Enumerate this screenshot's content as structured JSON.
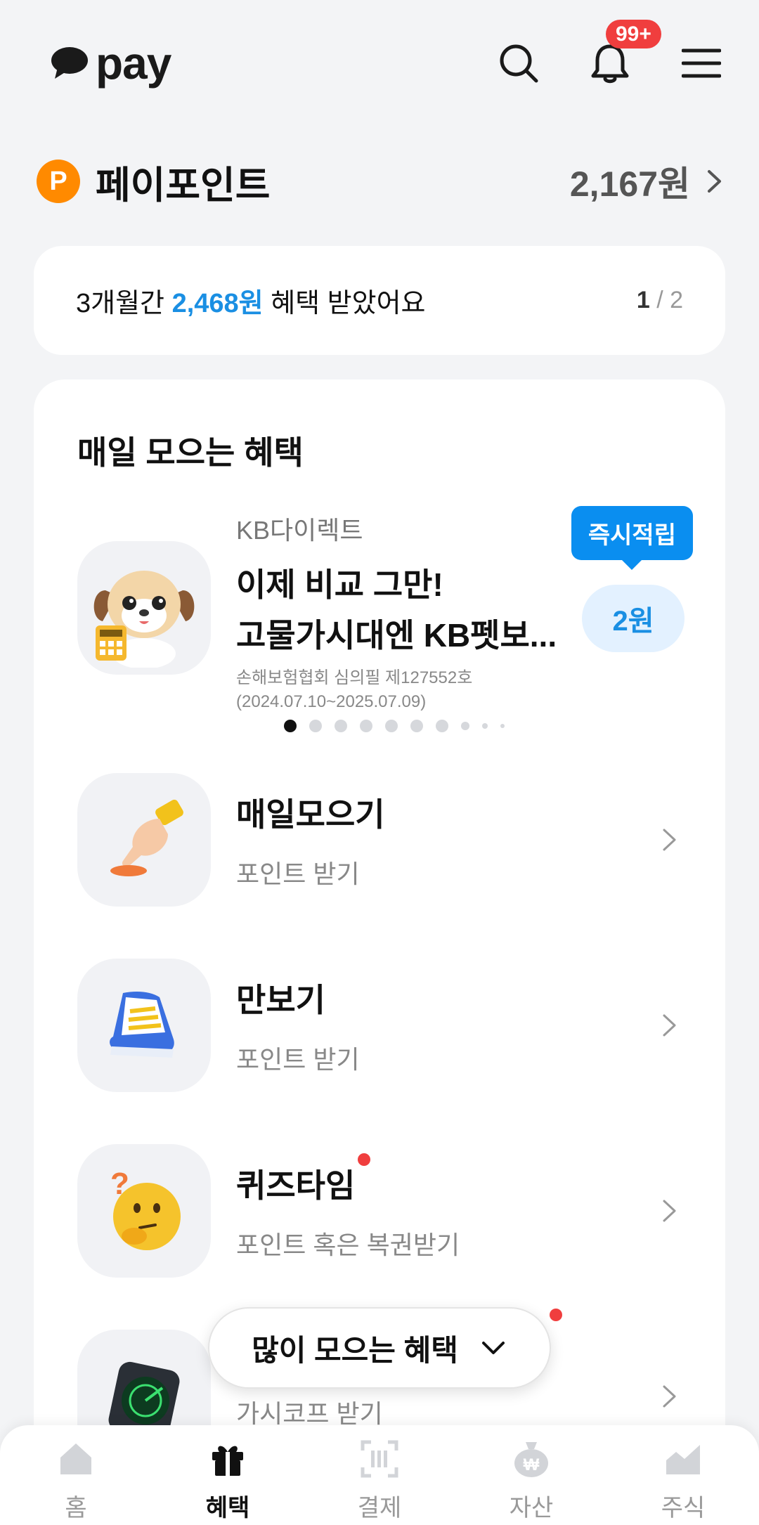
{
  "header": {
    "logo_text": "pay",
    "notification_badge": "99+",
    "icons": [
      "search-icon",
      "bell-icon",
      "menu-icon"
    ]
  },
  "pay_point": {
    "icon_letter": "P",
    "title": "페이포인트",
    "amount": "2,167원"
  },
  "summary": {
    "prefix": "3개월간 ",
    "amount": "2,468원",
    "suffix": " 혜택 받았어요",
    "page_current": "1",
    "page_total": " / 2"
  },
  "daily": {
    "title": "매일 모으는 혜택",
    "ad": {
      "advertiser": "KB다이렉트",
      "title_line1": "이제 비교 그만!",
      "title_line2": "고물가시대엔 KB펫보...",
      "legal_line1": "손해보험협회 심의필 제127552호",
      "legal_line2": "(2024.07.10~2025.07.09)",
      "tag": "즉시적립",
      "reward": "2원"
    },
    "items": [
      {
        "title": "매일모으기",
        "subtitle": "포인트 받기"
      },
      {
        "title": "만보기",
        "subtitle": "포인트 받기"
      },
      {
        "title": "퀴즈타임",
        "subtitle": "포인트 혹은 복권받기"
      },
      {
        "title": "",
        "subtitle": "가시코프 받기"
      }
    ]
  },
  "floating_pill": {
    "label": "많이 모으는 혜택"
  },
  "bottom_nav": [
    {
      "label": "홈",
      "icon": "home-icon"
    },
    {
      "label": "혜택",
      "icon": "gift-icon"
    },
    {
      "label": "결제",
      "icon": "barcode-scan-icon"
    },
    {
      "label": "자산",
      "icon": "money-bag-icon"
    },
    {
      "label": "주식",
      "icon": "stock-chart-icon"
    }
  ],
  "colors": {
    "accent_blue": "#1a8fe3",
    "point_orange": "#ff8a00",
    "alert_red": "#f03e3e"
  }
}
